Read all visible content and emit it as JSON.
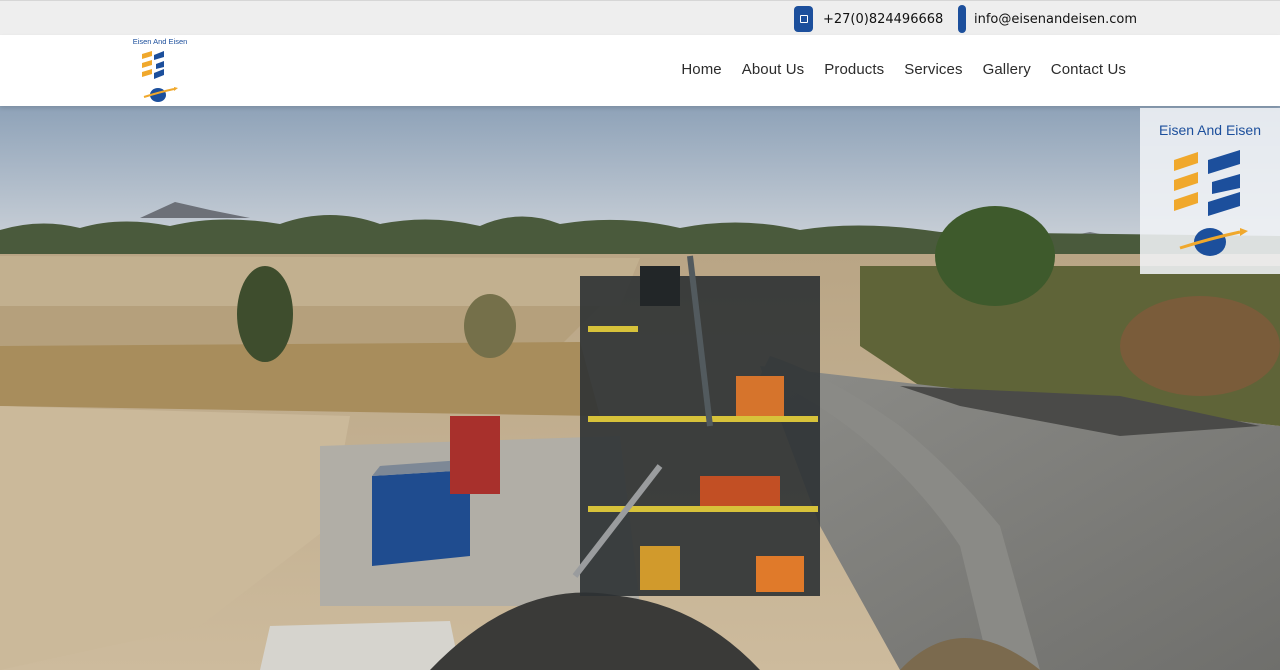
{
  "topbar": {
    "phone": "+27(0)824496668",
    "email": "info@eisenandeisen.com"
  },
  "brand": {
    "name": "Eisen And Eisen"
  },
  "nav": {
    "items": [
      {
        "label": "Home"
      },
      {
        "label": "About Us"
      },
      {
        "label": "Products"
      },
      {
        "label": "Services"
      },
      {
        "label": "Gallery"
      },
      {
        "label": "Contact Us"
      }
    ]
  },
  "icons": {
    "phone": "phone-icon",
    "email": "mail-icon",
    "logo": "eisen-logo-icon"
  },
  "colors": {
    "brand_blue": "#1c4f9c",
    "brand_orange": "#f0a82c",
    "topbar_bg": "#eeeeee"
  }
}
